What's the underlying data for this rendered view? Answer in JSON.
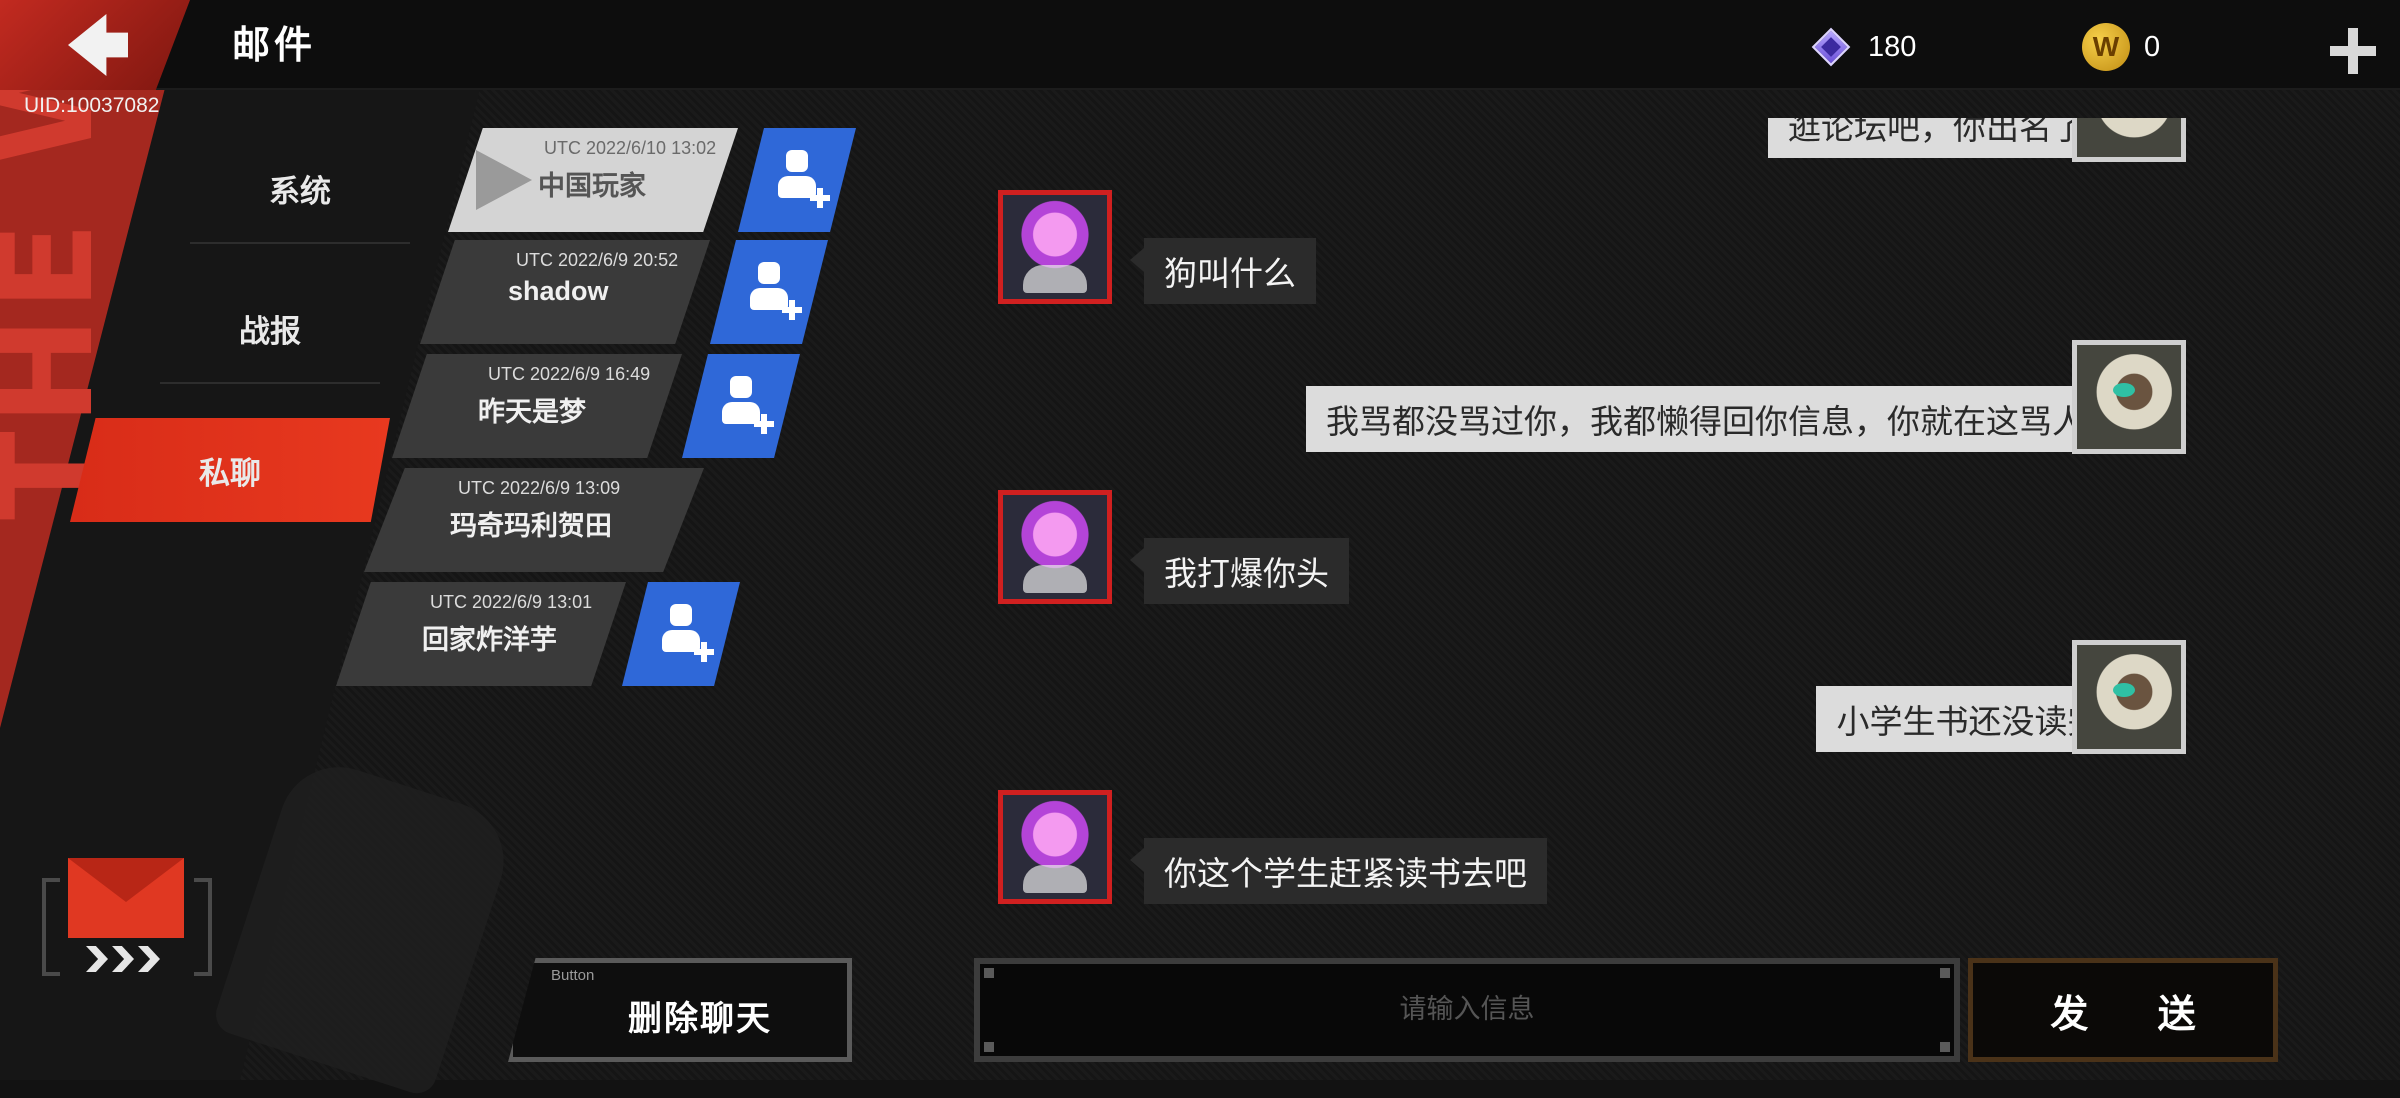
{
  "header": {
    "back_icon": "back-arrow-icon",
    "title": "邮件",
    "uid": "UID:10037082"
  },
  "currencies": {
    "gems": {
      "icon": "gem-icon",
      "value": "180"
    },
    "coins": {
      "icon": "coin-icon",
      "symbol": "W",
      "value": "0"
    },
    "add_icon": "plus-icon"
  },
  "tabs": [
    {
      "label": "系统",
      "active": false
    },
    {
      "label": "战报",
      "active": false
    },
    {
      "label": "私聊",
      "active": true
    }
  ],
  "contacts": [
    {
      "time": "UTC 2022/6/10 13:02",
      "name": "中国玩家",
      "selected": true,
      "can_add": true
    },
    {
      "time": "UTC 2022/6/9 20:52",
      "name": "shadow",
      "selected": false,
      "can_add": true
    },
    {
      "time": "UTC 2022/6/9 16:49",
      "name": "昨天是梦",
      "selected": false,
      "can_add": true
    },
    {
      "time": "UTC 2022/6/9 13:09",
      "name": "玛奇玛利贺田",
      "selected": false,
      "can_add": false
    },
    {
      "time": "UTC 2022/6/9 13:01",
      "name": "回家炸洋芋",
      "selected": false,
      "can_add": true
    }
  ],
  "chat": {
    "messages": [
      {
        "side": "right",
        "text": "逛论坛吧，你出名了。"
      },
      {
        "side": "left",
        "text": "狗叫什么"
      },
      {
        "side": "right",
        "text": "我骂都没骂过你，我都懒得回你信息，你就在这骂人。"
      },
      {
        "side": "left",
        "text": "我打爆你头"
      },
      {
        "side": "right",
        "text": "小学生书还没读完?"
      },
      {
        "side": "left",
        "text": "你这个学生赶紧读书去吧"
      }
    ]
  },
  "bottom": {
    "delete_tag": "Button",
    "delete_label": "删除聊天",
    "input_placeholder": "请输入信息",
    "send_label": "发 送"
  },
  "decor": {
    "wall_text": "THE WAR"
  },
  "colors": {
    "accent_red": "#e0371f",
    "add_friend_blue": "#2f68d8"
  }
}
